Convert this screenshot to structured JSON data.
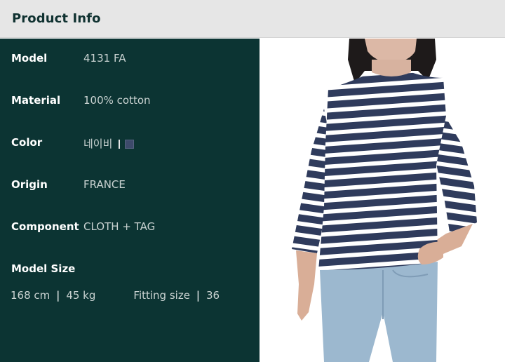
{
  "header": {
    "title": "Product Info"
  },
  "specs": [
    {
      "label": "Model",
      "value": "4131 FA"
    },
    {
      "label": "Material",
      "value": "100% cotton"
    },
    {
      "label": "Color",
      "value": "네이비"
    },
    {
      "label": "Origin",
      "value": "FRANCE"
    },
    {
      "label": "Component",
      "value": "CLOTH + TAG"
    }
  ],
  "model_size": {
    "label": "Model Size",
    "height": "168 cm",
    "weight": "45 kg",
    "fitting_label": "Fitting size",
    "fitting_value": "36",
    "separator": "|"
  },
  "colors": {
    "header_bg": "#e6e6e6",
    "panel_bg": "#0c3433",
    "swatch_navy": "#3d4a6b",
    "shirt_navy": "#2f3b5c",
    "jeans": "#9cb8cf"
  }
}
